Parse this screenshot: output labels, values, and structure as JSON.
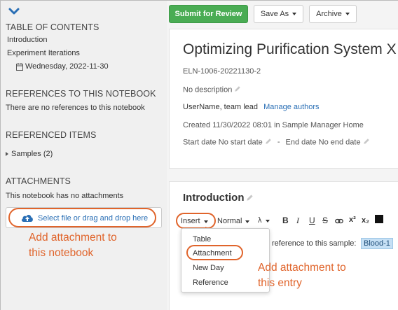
{
  "sidebar": {
    "toc_title": "TABLE OF CONTENTS",
    "toc_items": [
      "Introduction",
      "Experiment Iterations"
    ],
    "toc_date": "Wednesday, 2022-11-30",
    "references_title": "REFERENCES TO THIS NOTEBOOK",
    "references_empty": "There are no references to this notebook",
    "referenced_items_title": "REFERENCED ITEMS",
    "referenced_item": "Samples (2)",
    "attachments_title": "ATTACHMENTS",
    "attachments_empty": "This notebook has no attachments",
    "dropzone_label": "Select file or drag and drop here",
    "annotation": "Add attachment to\nthis notebook"
  },
  "toolbar": {
    "submit_label": "Submit for Review",
    "save_as_label": "Save As",
    "archive_label": "Archive"
  },
  "notebook": {
    "title": "Optimizing Purification System X",
    "id": "ELN-1006-20221130-2",
    "description": "No description",
    "author": "UserName, team lead",
    "manage_authors": "Manage authors",
    "created": "Created 11/30/2022 08:01 in Sample Manager Home",
    "start_label": "Start date",
    "start_value": "No start date",
    "dash": "-",
    "end_label": "End date",
    "end_value": "No end date"
  },
  "entry": {
    "title": "Introduction",
    "insert_label": "Insert",
    "format_label": "Normal",
    "lambda": "λ",
    "bold": "B",
    "italic": "I",
    "underline": "U",
    "strike": "S",
    "superscript": "x²",
    "subscript": "x₂",
    "insert_menu": [
      "Table",
      "Attachment",
      "New Day",
      "Reference"
    ],
    "body_text": "reference to this sample:",
    "sample_badge": "Blood-1",
    "annotation": "Add attachment to\nthis entry"
  },
  "colors": {
    "annotation": "#e0642b",
    "primary_button": "#4aac54",
    "link": "#2a6fb5",
    "accent_icon": "#2a6fb5"
  }
}
